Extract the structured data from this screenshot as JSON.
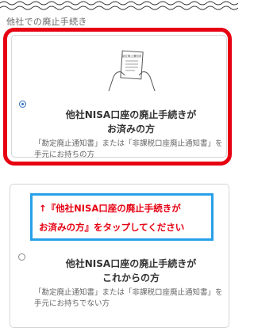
{
  "section": {
    "title": "他社での廃止手続き"
  },
  "options": [
    {
      "title": "他社NISA口座の廃止手続きが\nお済みの方",
      "description": "「勘定廃止通知書」または「非課税口座廃止通知書」を手元にお持ちの方",
      "illustration_caption": "勘定廃止通知書",
      "selected": true
    },
    {
      "title": "他社NISA口座の廃止手続きが\nこれからの方",
      "description": "「勘定廃止通知書」または「非課税口座廃止通知書」を手元にお持ちでない方",
      "selected": false
    }
  ],
  "callout": {
    "line1": "↑『他社NISA口座の廃止手続きが",
    "line2": "お済みの方』をタップしてください"
  },
  "colors": {
    "highlight_red": "#e60012",
    "callout_blue": "#27a0e8",
    "radio_blue": "#2f6fc6"
  },
  "icons": {
    "illustration": "hands-holding-document-icon",
    "selected_radio": "radio-checked-icon",
    "unselected_radio": "radio-unchecked-icon"
  }
}
